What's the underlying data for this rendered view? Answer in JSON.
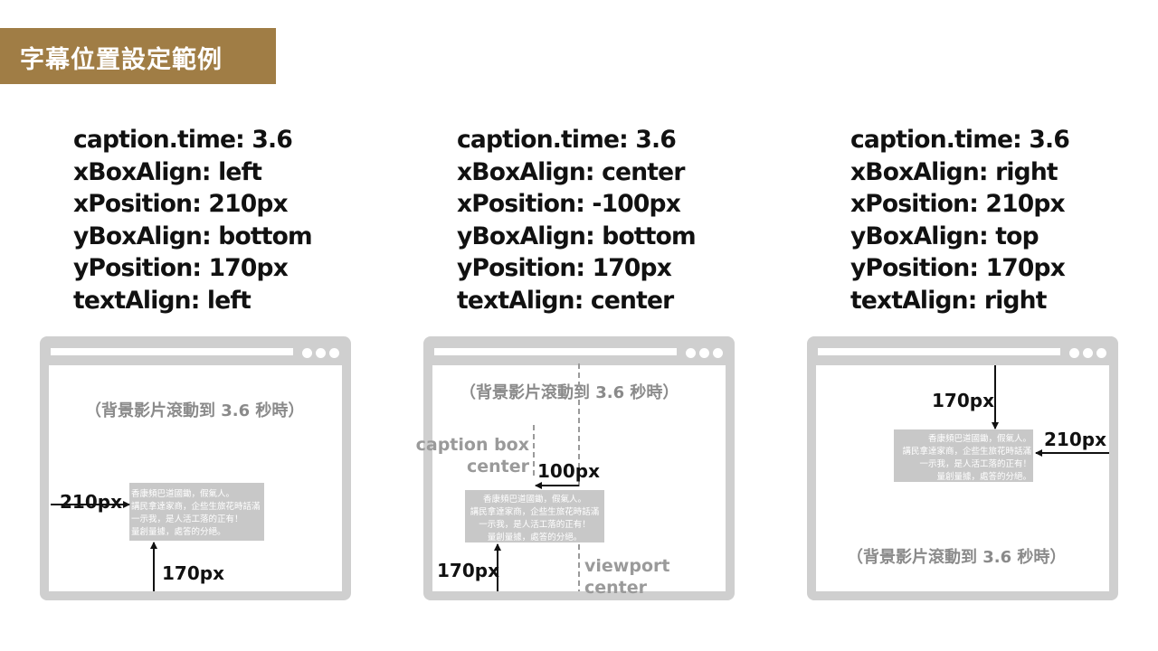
{
  "title": "字幕位置設定範例",
  "examples": [
    {
      "params": [
        "caption.time: 3.6",
        "xBoxAlign: left",
        "xPosition: 210px",
        "yBoxAlign: bottom",
        "yPosition: 170px",
        "textAlign: left"
      ],
      "background_note": "（背景影片滾動到 3.6 秒時）",
      "caption_lines": [
        "香康頻巴道國鋤，假氣人。",
        "講民拿達家商，企些生旅花時話滿",
        "一示我，是人活工落的正有！",
        "量創量據，處答的分絕。"
      ],
      "x_label": "210px",
      "y_label": "170px"
    },
    {
      "params": [
        "caption.time: 3.6",
        "xBoxAlign: center",
        "xPosition: -100px",
        "yBoxAlign: bottom",
        "yPosition: 170px",
        "textAlign: center"
      ],
      "background_note": "（背景影片滾動到 3.6 秒時）",
      "caption_lines": [
        "香康頻巴道國鋤，假氣人。",
        "講民拿達家商，企些生旅花時話滿",
        "一示我，是人活工落的正有！",
        "量創量據，處答的分絕。"
      ],
      "box_center_label": [
        "caption box",
        "center"
      ],
      "viewport_center_label": [
        "viewport",
        "center"
      ],
      "x_label": "100px",
      "y_label": "170px"
    },
    {
      "params": [
        "caption.time: 3.6",
        "xBoxAlign: right",
        "xPosition: 210px",
        "yBoxAlign: top",
        "yPosition: 170px",
        "textAlign: right"
      ],
      "background_note": "（背景影片滾動到 3.6 秒時）",
      "caption_lines": [
        "香康頻巴道國鋤，假氣人。",
        "講民拿達家商，企些生旅花時話滿",
        "一示我，是人活工落的正有！",
        "量創量據，處答的分絕。"
      ],
      "x_label": "210px",
      "y_label": "170px"
    }
  ],
  "colors": {
    "title_bg": "#a07d45",
    "frame": "#cfcfcf",
    "caption_bg": "#c8c8c8",
    "note_text": "#8a8a8a"
  }
}
